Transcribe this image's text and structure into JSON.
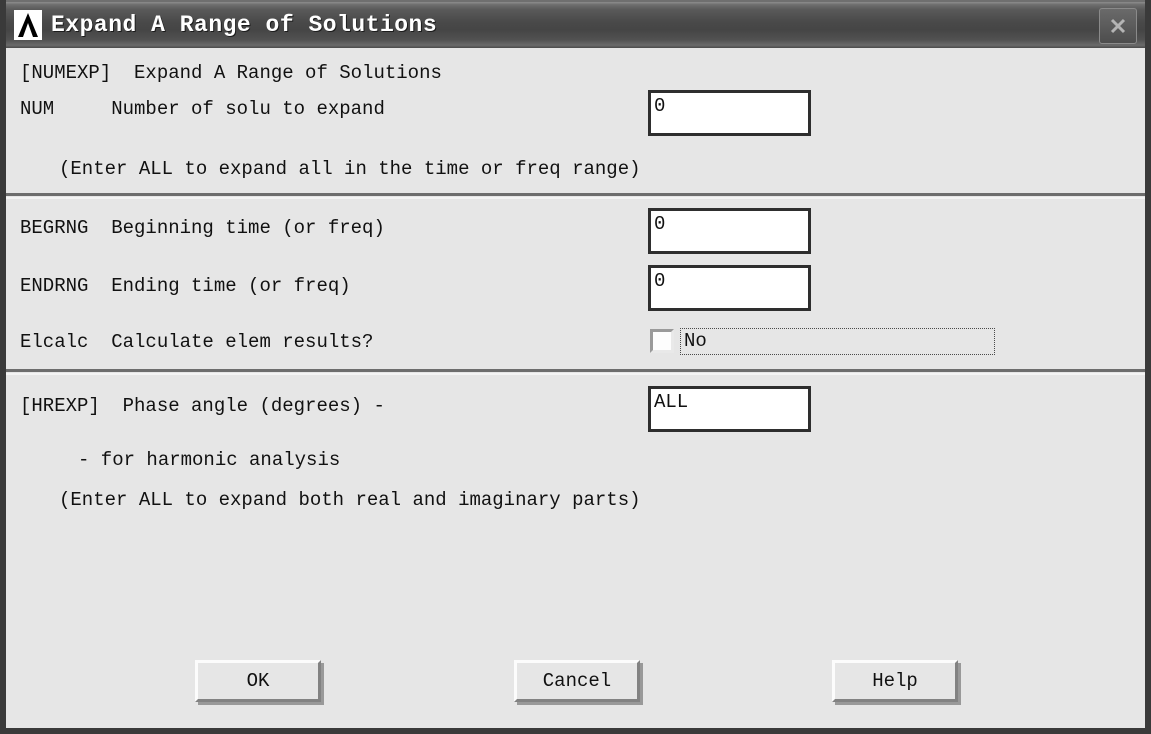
{
  "window": {
    "title": "Expand A Range of Solutions",
    "app_icon": "ansys-lambda-icon",
    "close_icon": "close-icon"
  },
  "sections": [
    {
      "id": "numexp",
      "command_label": "[NUMEXP]  Expand A Range of Solutions",
      "rows": [
        {
          "param": "NUM",
          "label": "NUM     Number of solu to expand",
          "field_value": "0"
        }
      ],
      "note": "(Enter ALL to expand all in the time or freq range)"
    },
    {
      "id": "range",
      "rows": [
        {
          "param": "BEGRNG",
          "label": "BEGRNG  Beginning time (or freq)",
          "field_value": "0"
        },
        {
          "param": "ENDRNG",
          "label": "ENDRNG  Ending time (or freq)",
          "field_value": "0"
        },
        {
          "param": "Elcalc",
          "label": "Elcalc  Calculate elem results?",
          "checkbox_checked": false,
          "option_value": "No"
        }
      ]
    },
    {
      "id": "hrexp",
      "command_label": "[HREXP]  Phase angle (degrees) -",
      "field_value": "ALL",
      "sub_label": "- for harmonic analysis",
      "note": "(Enter ALL to expand both real and imaginary parts)"
    }
  ],
  "buttons": {
    "ok": "OK",
    "cancel": "Cancel",
    "help": "Help"
  },
  "colors": {
    "dialog_face": "#e6e6e6",
    "frame": "#3a3a3a",
    "titlebar_dark": "#454545",
    "field_border": "#2e2e2e",
    "text": "#111111"
  }
}
